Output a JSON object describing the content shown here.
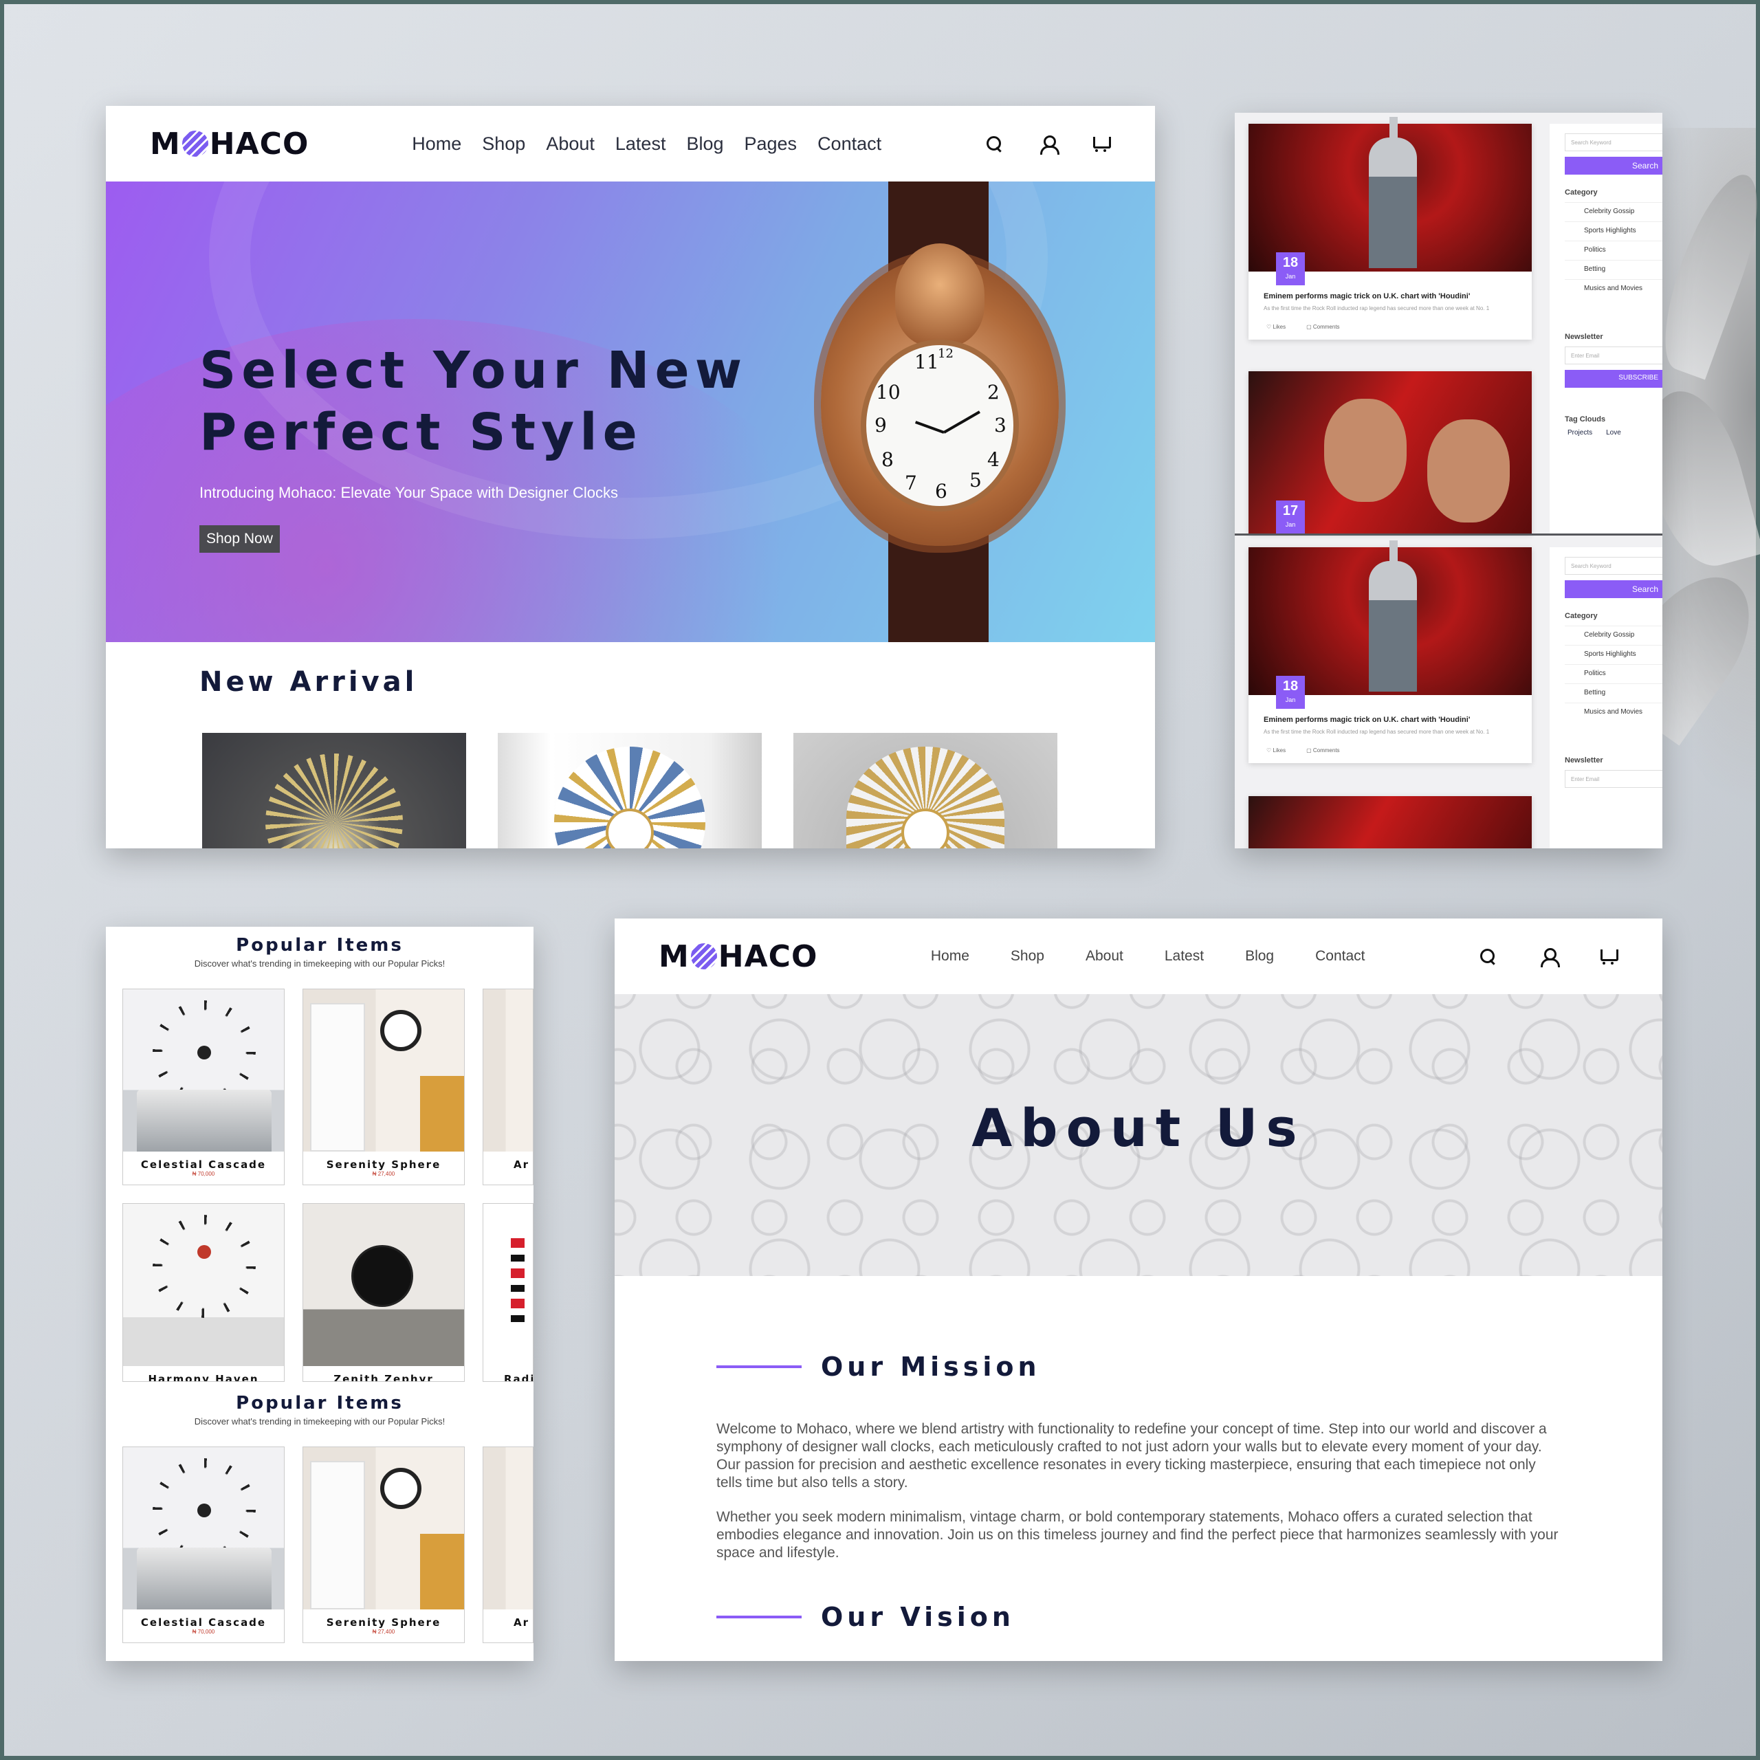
{
  "brand": {
    "name_left": "M",
    "name_right": "HACO",
    "accent": "#8b5cf6"
  },
  "nav": {
    "items": [
      "Home",
      "Shop",
      "About",
      "Latest",
      "Blog",
      "Pages",
      "Contact"
    ]
  },
  "hero": {
    "title": "Select Your New\nPerfect Style",
    "subtitle": "Introducing Mohaco: Elevate Your Space with Designer Clocks",
    "button": "Shop Now",
    "clock_numbers": [
      "11",
      "10",
      "9",
      "8",
      "7",
      "6",
      "5",
      "4",
      "3",
      "2",
      "12"
    ]
  },
  "new_arrival": {
    "heading": "New Arrival"
  },
  "blog": {
    "posts": [
      {
        "day": "18",
        "month": "Jan",
        "title": "Eminem performs magic trick on U.K. chart with 'Houdini'",
        "excerpt": "As the first time the Rock Roll inducted rap legend has secured more than one week at No. 1",
        "likes": "Likes",
        "comments": "Comments"
      },
      {
        "day": "17",
        "month": "Jan"
      },
      {
        "day": "18",
        "month": "Jan",
        "title": "Eminem performs magic trick on U.K. chart with 'Houdini'",
        "excerpt": "As the first time the Rock Roll inducted rap legend has secured more than one week at No. 1",
        "likes": "Likes",
        "comments": "Comments"
      }
    ],
    "sidebar": {
      "search_placeholder": "Search Keyword",
      "search_button": "Search",
      "category_heading": "Category",
      "categories": [
        "Celebrity Gossip",
        "Sports Highlights",
        "Politics",
        "Betting",
        "Musics and Movies"
      ],
      "newsletter_heading": "Newsletter",
      "email_placeholder": "Enter Email",
      "subscribe_button": "SUBSCRIBE",
      "tag_heading": "Tag Clouds",
      "tags": [
        "Projects",
        "Love"
      ]
    }
  },
  "popular": {
    "heading": "Popular Items",
    "subheading": "Discover what's trending in timekeeping with our Popular Picks!",
    "row1": [
      {
        "name": "Celestial Cascade",
        "price": "₦ 70,000"
      },
      {
        "name": "Serenity Sphere",
        "price": "₦ 27,400"
      },
      {
        "name": "Ar"
      }
    ],
    "row2": [
      {
        "name": "Harmony Haven"
      },
      {
        "name": "Zenith Zephyr"
      },
      {
        "name": "Radi"
      }
    ],
    "row3": [
      {
        "name": "Celestial Cascade",
        "price": "₦ 70,000"
      },
      {
        "name": "Serenity Sphere",
        "price": "₦ 27,400"
      },
      {
        "name": "Ar"
      }
    ]
  },
  "about": {
    "nav_items": [
      "Home",
      "Shop",
      "About",
      "Latest",
      "Blog",
      "Contact"
    ],
    "title": "About Us",
    "mission_heading": "Our Mission",
    "mission_p1": "Welcome to Mohaco, where we blend artistry with functionality to redefine your concept of time. Step into our world and discover a symphony of designer wall clocks, each meticulously crafted to not just adorn your walls but to elevate every moment of your day. Our passion for precision and aesthetic excellence resonates in every ticking masterpiece, ensuring that each timepiece not only tells time but also tells a story.",
    "mission_p2": "Whether you seek modern minimalism, vintage charm, or bold contemporary statements, Mohaco offers a curated selection that embodies elegance and innovation. Join us on this timeless journey and find the perfect piece that harmonizes seamlessly with your space and lifestyle.",
    "vision_heading": "Our Vision"
  }
}
